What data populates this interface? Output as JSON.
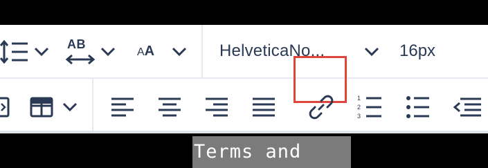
{
  "toolbar": {
    "row1": {
      "line_height_icon": "line-height-icon",
      "text_transform_label": "AB",
      "font_size_label_small": "A",
      "font_size_label_big": "A",
      "font_family_value": "HelveticaNo...",
      "font_size_value": "16px"
    },
    "row2": {
      "icons": [
        "image-icon",
        "table-icon",
        "align-left-icon",
        "align-center-icon",
        "align-right-icon",
        "align-justify-icon",
        "link-icon",
        "numbered-list-icon",
        "bullet-list-icon",
        "outdent-icon"
      ]
    },
    "highlight_color": "#e0453a",
    "icon_color": "#2a3a55"
  },
  "document": {
    "visible_text": "Terms and"
  }
}
